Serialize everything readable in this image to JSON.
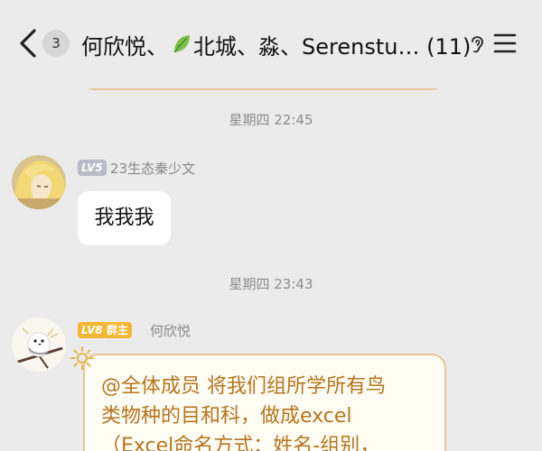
{
  "header": {
    "unread_count": "3",
    "title_before_leaf": "何欣悦、",
    "title_after_leaf": "北城、淼、Serenstu… (11)"
  },
  "messages": [
    {
      "timestamp": "星期四 22:45",
      "level": "LV5",
      "sender": "23生态秦少文",
      "text": "我我我"
    },
    {
      "timestamp": "星期四 23:43",
      "level": "LV8",
      "role": "群主",
      "sender": "何欣悦",
      "lines": [
        "@全体成员 将我们组所学所有鸟",
        "类物种的目和科，做成excel",
        "（Excel命名方式：姓名-组别，"
      ]
    }
  ],
  "colors": {
    "lv5": "#b7bcc6",
    "lv8": "#f5b733",
    "notice_text": "#b4751e",
    "notice_border": "#e7c592"
  }
}
